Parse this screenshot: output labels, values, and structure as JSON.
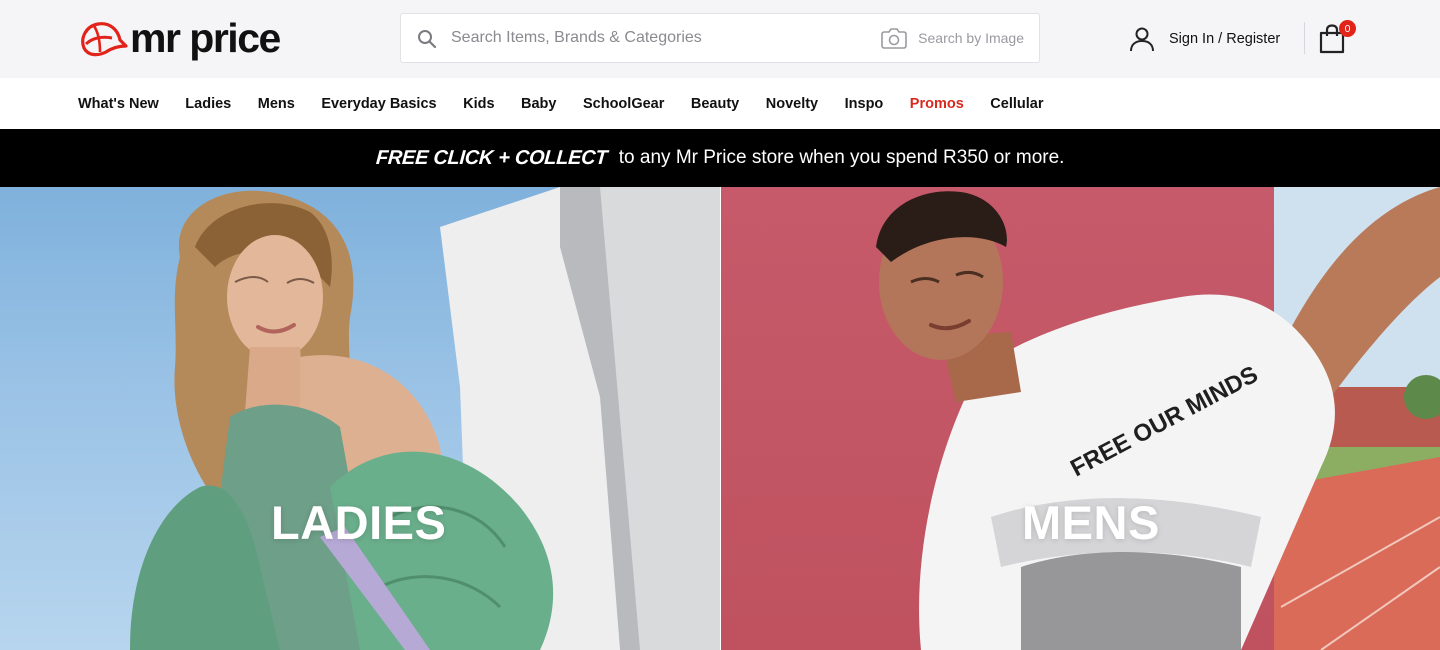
{
  "brand": {
    "name": "mr price",
    "accent": "#e2231a"
  },
  "search": {
    "placeholder": "Search Items, Brands & Categories",
    "image_search_label": "Search by Image"
  },
  "account": {
    "label": "Sign In / Register"
  },
  "cart": {
    "count": "0"
  },
  "nav": {
    "items": [
      {
        "label": "What's New"
      },
      {
        "label": "Ladies"
      },
      {
        "label": "Mens"
      },
      {
        "label": "Everyday Basics"
      },
      {
        "label": "Kids"
      },
      {
        "label": "Baby"
      },
      {
        "label": "SchoolGear"
      },
      {
        "label": "Beauty"
      },
      {
        "label": "Novelty"
      },
      {
        "label": "Inspo"
      },
      {
        "label": "Promos",
        "color": "#d8291f"
      },
      {
        "label": "Cellular"
      }
    ]
  },
  "promo_banner": {
    "highlight": "FREE CLICK + COLLECT",
    "text": "to any Mr Price store when you spend R350 or more."
  },
  "hero": {
    "ladies_label": "LADIES",
    "mens_label": "MENS",
    "tshirt_print": "FREE OUR MINDS"
  },
  "icons": {
    "search": "search-icon",
    "camera": "camera-icon",
    "user": "user-icon",
    "bag": "shopping-bag-icon",
    "logo": "cap-logo-icon"
  }
}
